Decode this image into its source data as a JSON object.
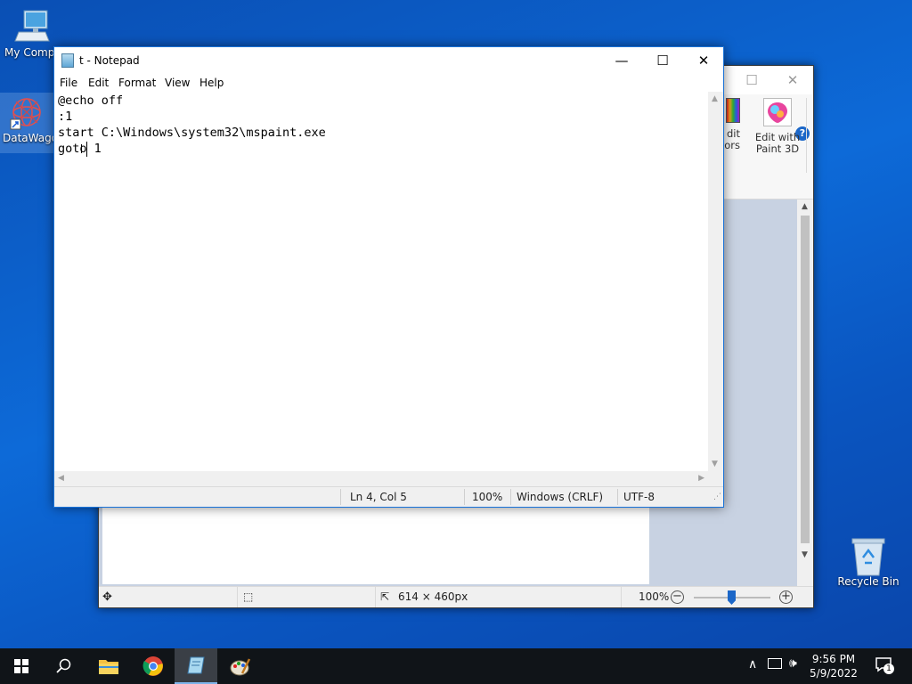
{
  "desktop": {
    "icons": [
      {
        "label": "My Compu",
        "name": "my-computer"
      },
      {
        "label": "DataWago",
        "name": "datawago"
      },
      {
        "label": "Recycle Bin",
        "name": "recycle-bin"
      }
    ]
  },
  "paint": {
    "ribbon": {
      "edit_colors_line1": "dit",
      "edit_colors_line2": "lors",
      "paint3d_line1": "Edit with",
      "paint3d_line2": "Paint 3D"
    },
    "status": {
      "image_size": "614 × 460px",
      "zoom": "100%"
    }
  },
  "notepad": {
    "title": "t - Notepad",
    "menu": [
      "File",
      "Edit",
      "Format",
      "View",
      "Help"
    ],
    "lines": [
      "@echo off",
      ":1",
      "start C:\\Windows\\system32\\mspaint.exe",
      "goto 1"
    ],
    "status": {
      "position": "Ln 4, Col 5",
      "zoom": "100%",
      "line_ending": "Windows (CRLF)",
      "encoding": "UTF-8"
    }
  },
  "taskbar": {
    "time": "9:56 PM",
    "date": "5/9/2022",
    "notification_count": "1"
  }
}
